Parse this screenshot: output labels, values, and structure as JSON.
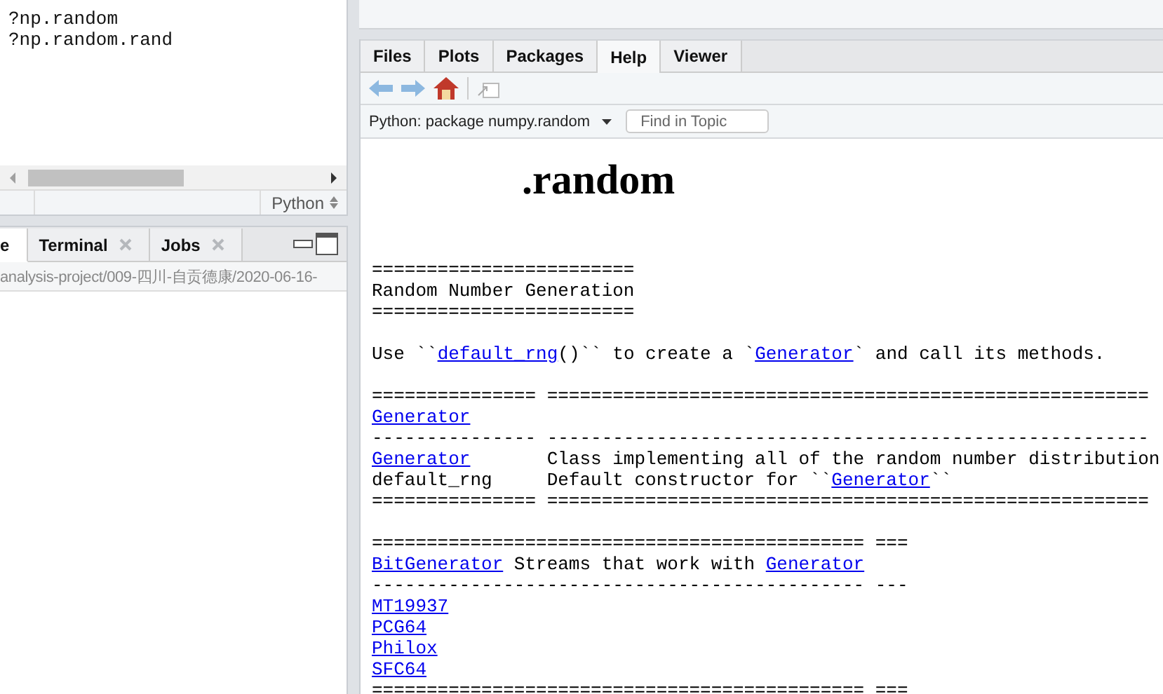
{
  "editor": {
    "lines": [
      "?np.random",
      "?np.random.rand"
    ],
    "language": "Python"
  },
  "console": {
    "tabs": [
      {
        "label": "e",
        "selected": true,
        "closable": false
      },
      {
        "label": "Terminal",
        "selected": false,
        "closable": true
      },
      {
        "label": "Jobs",
        "selected": false,
        "closable": true
      }
    ],
    "path": "analysis-project/009-四川-自贡德康/2020-06-16-"
  },
  "help_pane": {
    "tabs": [
      {
        "label": "Files",
        "selected": false
      },
      {
        "label": "Plots",
        "selected": false
      },
      {
        "label": "Packages",
        "selected": false
      },
      {
        "label": "Help",
        "selected": true
      },
      {
        "label": "Viewer",
        "selected": false
      }
    ],
    "topic": "Python: package numpy.random",
    "search": {
      "placeholder": "Find in Topic"
    },
    "heading": ".random",
    "blocks": [
      [
        [
          {
            "text": "========================",
            "link": false
          }
        ],
        [
          {
            "text": "Random Number Generation",
            "link": false
          }
        ],
        [
          {
            "text": "========================",
            "link": false
          }
        ]
      ],
      [
        [
          {
            "text": "Use ``",
            "link": false
          },
          {
            "text": "default_rng",
            "link": true
          },
          {
            "text": "()`` to create a `",
            "link": false
          },
          {
            "text": "Generator",
            "link": true
          },
          {
            "text": "` and call its methods.",
            "link": false
          }
        ]
      ],
      [
        [
          {
            "text": "=============== =======================================================",
            "link": false
          }
        ],
        [
          {
            "text": "Generator",
            "link": true
          }
        ],
        [
          {
            "text": "--------------- -------------------------------------------------------",
            "link": false
          }
        ],
        [
          {
            "text": "Generator",
            "link": true
          },
          {
            "text": "       Class implementing all of the random number distribution",
            "link": false
          }
        ],
        [
          {
            "text": "default_rng     Default constructor for ``",
            "link": false
          },
          {
            "text": "Generator",
            "link": true
          },
          {
            "text": "``",
            "link": false
          }
        ],
        [
          {
            "text": "=============== =======================================================",
            "link": false
          }
        ]
      ],
      [
        [
          {
            "text": "============================================= ===",
            "link": false
          }
        ],
        [
          {
            "text": "BitGenerator",
            "link": true
          },
          {
            "text": " Streams that work with ",
            "link": false
          },
          {
            "text": "Generator",
            "link": true
          }
        ],
        [
          {
            "text": "--------------------------------------------- ---",
            "link": false
          }
        ],
        [
          {
            "text": "MT19937",
            "link": true
          }
        ],
        [
          {
            "text": "PCG64",
            "link": true
          }
        ],
        [
          {
            "text": "Philox",
            "link": true
          }
        ],
        [
          {
            "text": "SFC64",
            "link": true
          }
        ],
        [
          {
            "text": "============================================= ===",
            "link": false
          }
        ]
      ]
    ]
  }
}
